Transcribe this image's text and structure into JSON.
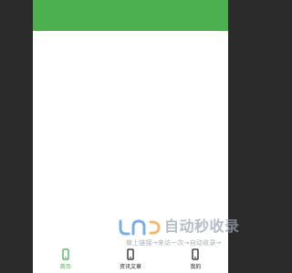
{
  "colors": {
    "accent": "#4cb050",
    "backdrop": "#2b2b2b",
    "content_bg": "#ffffff"
  },
  "tabbar": {
    "tabs": [
      {
        "label": "首页",
        "icon": "phone-icon",
        "active": true
      },
      {
        "label": "资讯文章",
        "icon": "phone-icon",
        "active": false
      },
      {
        "label": "我的",
        "icon": "phone-icon",
        "active": false
      }
    ]
  },
  "watermark": {
    "title": "自动秒收录",
    "subtitle": "做上链接→来访一次→自动收录→"
  }
}
